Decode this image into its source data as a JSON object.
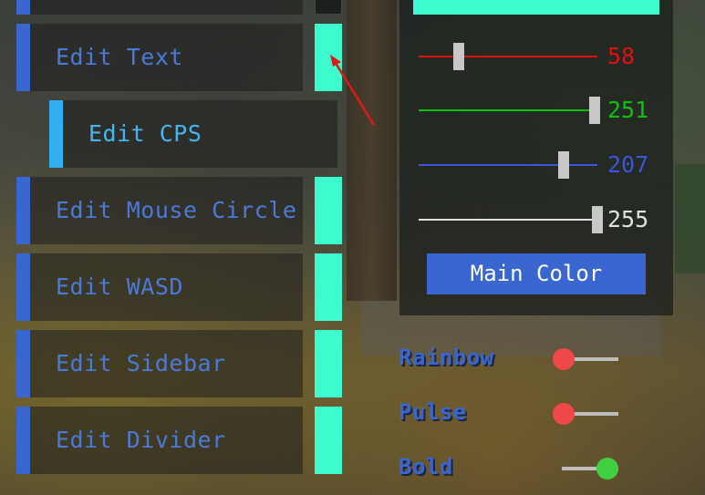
{
  "edit_list": [
    {
      "label": "Edit Text"
    },
    {
      "label": "Edit CPS"
    },
    {
      "label": "Edit Mouse Circle"
    },
    {
      "label": "Edit WASD"
    },
    {
      "label": "Edit Sidebar"
    },
    {
      "label": "Edit Divider"
    }
  ],
  "color_panel": {
    "preview_color": "#3dfbcf",
    "sliders": [
      {
        "name": "red",
        "value": "58",
        "color": "#e01010",
        "fraction": 0.227
      },
      {
        "name": "green",
        "value": "251",
        "color": "#10c010",
        "fraction": 0.984
      },
      {
        "name": "blue",
        "value": "207",
        "color": "#3a55d8",
        "fraction": 0.812
      },
      {
        "name": "alpha",
        "value": "255",
        "color": "#e0e0e0",
        "fraction": 1.0
      }
    ],
    "main_color_button": "Main Color"
  },
  "toggles": [
    {
      "label": "Rainbow",
      "on": false,
      "knob_color": "#f04848"
    },
    {
      "label": "Pulse",
      "on": false,
      "knob_color": "#f04848"
    },
    {
      "label": "Bold",
      "on": true,
      "knob_color": "#40d040"
    }
  ],
  "colors": {
    "accent_blue": "#3a66d0",
    "swatch": "#3dfbcf",
    "sub_accent": "#30b0f0"
  }
}
